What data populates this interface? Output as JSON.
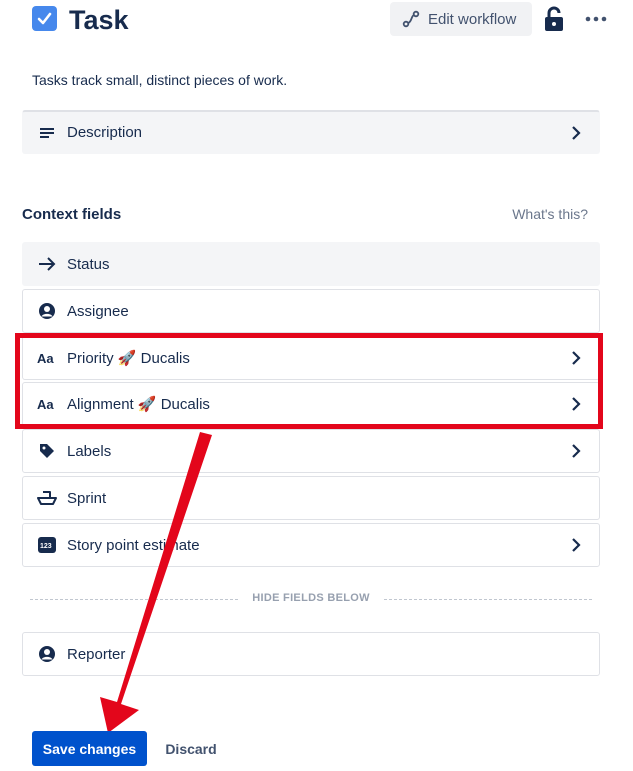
{
  "header": {
    "title": "Task",
    "edit_workflow_label": "Edit workflow"
  },
  "description_text": "Tasks track small, distinct pieces of work.",
  "top_field": {
    "label": "Description",
    "icon": "text-lines-icon"
  },
  "context": {
    "title": "Context fields",
    "whats_this": "What's this?",
    "fields": [
      {
        "label": "Status",
        "icon": "arrow-right-icon",
        "chevron": false
      },
      {
        "label": "Assignee",
        "icon": "user-avatar-icon",
        "chevron": false
      },
      {
        "label": "Priority 🚀 Ducalis",
        "icon": "text-aa-icon",
        "chevron": true
      },
      {
        "label": "Alignment 🚀 Ducalis",
        "icon": "text-aa-icon",
        "chevron": true
      },
      {
        "label": "Labels",
        "icon": "tag-icon",
        "chevron": true
      },
      {
        "label": "Sprint",
        "icon": "ship-icon",
        "chevron": false
      },
      {
        "label": "Story point estimate",
        "icon": "number-123-icon",
        "chevron": true
      }
    ],
    "hide_fields_label": "HIDE FIELDS BELOW",
    "hidden_fields": [
      {
        "label": "Reporter",
        "icon": "user-avatar-icon",
        "chevron": false
      }
    ]
  },
  "actions": {
    "save_label": "Save changes",
    "discard_label": "Discard"
  },
  "colors": {
    "highlight": "#e3061b",
    "primary": "#0052cc",
    "checkbox": "#4688ec"
  }
}
